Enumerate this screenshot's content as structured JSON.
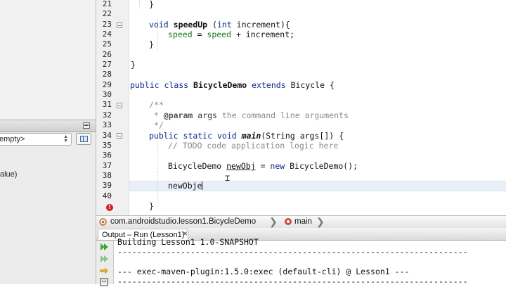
{
  "left_panel": {
    "filter_value": "empty>",
    "value_label": "alue)"
  },
  "gutter": {
    "line_numbers": [
      "21",
      "22",
      "23",
      "24",
      "25",
      "26",
      "27",
      "28",
      "29",
      "30",
      "31",
      "32",
      "33",
      "34",
      "35",
      "36",
      "37",
      "38",
      "39",
      "40"
    ]
  },
  "editor": {
    "line21": {
      "brace": "}"
    },
    "line23": {
      "kw_void": "void",
      "method": "speedUp",
      "open": " (",
      "kw_int": "int",
      "rest": " increment){"
    },
    "line24": {
      "field1": "speed",
      "eq": " = ",
      "field2": "speed",
      "rest": " + increment;"
    },
    "line25": {
      "brace": "}"
    },
    "line27": {
      "brace": "}"
    },
    "line29": {
      "kw_public": "public",
      "kw_class": "class",
      "name": "BicycleDemo",
      "kw_extends": "extends",
      "rest": "Bicycle {"
    },
    "line31": {
      "text": "/**"
    },
    "line32": {
      "star": " * ",
      "tag": "@param",
      "param": " args",
      "rest": " the command line arguments"
    },
    "line33": {
      "text": " */"
    },
    "line34": {
      "kw_public": "public",
      "kw_static": "static",
      "kw_void": "void",
      "method": "main",
      "rest": "(String args[]) {"
    },
    "line35": {
      "text": "// TODO code application logic here"
    },
    "line37": {
      "type": "BicycleDemo ",
      "var": "newObj",
      "eq": " = ",
      "kw_new": "new",
      "rest": " BicycleDemo();"
    },
    "line39": {
      "typed": "newObje"
    },
    "line41": {
      "brace": "}"
    }
  },
  "breadcrumb": {
    "class_path": "com.androidstudio.lesson1.BicycleDemo",
    "method": "main"
  },
  "output": {
    "tab_label": "Output – Run (Lesson1)",
    "close_glyph": "×",
    "lines": [
      "Building Lesson1 1.0-SNAPSHOT",
      "------------------------------------------------------------------------",
      "",
      "--- exec-maven-plugin:1.5.0:exec (default-cli) @ Lesson1 ---",
      "------------------------------------------------------------------------"
    ]
  }
}
